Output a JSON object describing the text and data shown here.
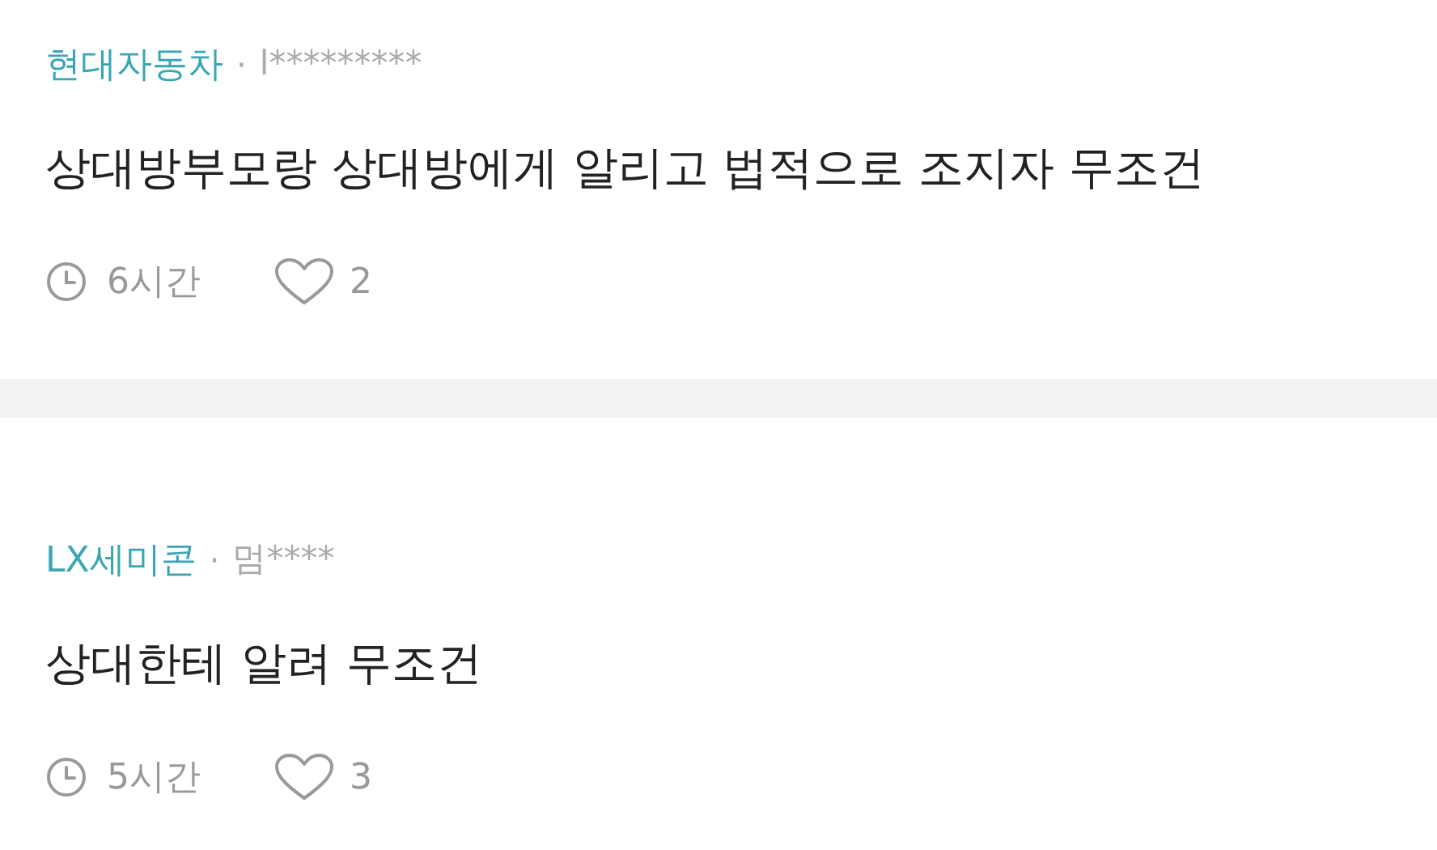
{
  "comments": [
    {
      "company": "현대자동차",
      "separator": "·",
      "author": "l*********",
      "text": "상대방부모랑 상대방에게 알리고 법적으로 조지자 무조건",
      "time": "6시간",
      "likes": "2"
    },
    {
      "company": "LX세미콘",
      "separator": "·",
      "author": "멈****",
      "text": "상대한테 알려 무조건",
      "time": "5시간",
      "likes": "3"
    }
  ]
}
